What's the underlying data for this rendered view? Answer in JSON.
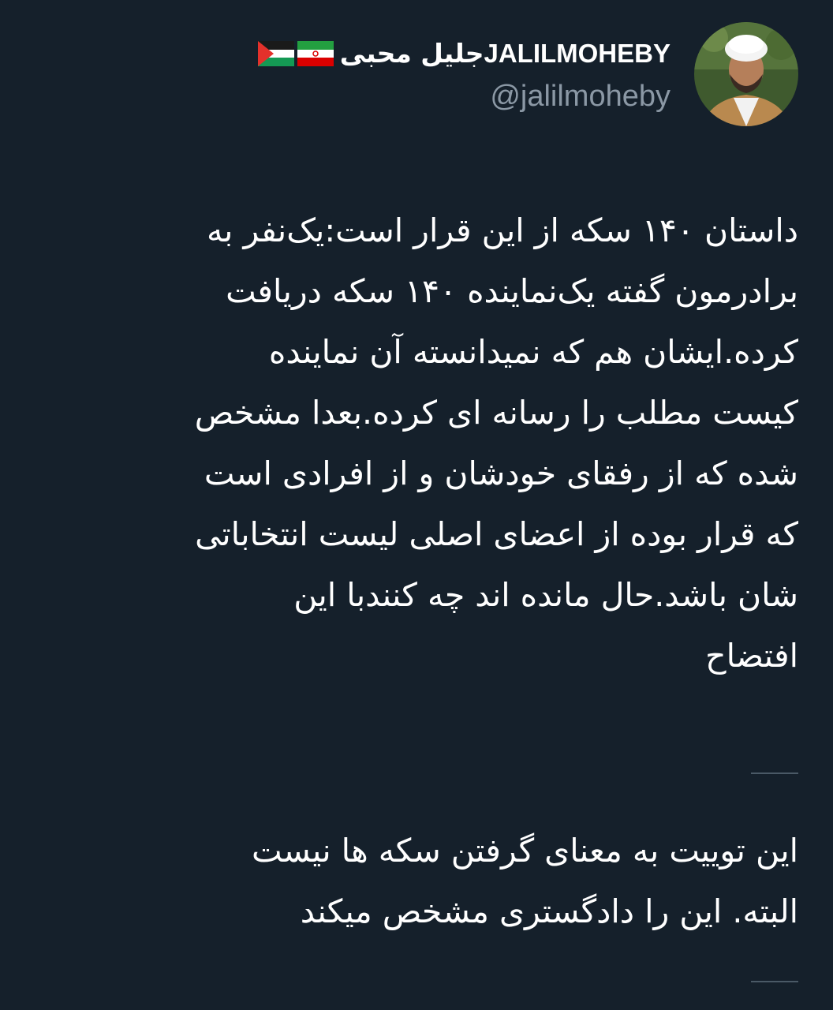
{
  "tweet": {
    "author": {
      "display_name_fa": "جلیل محبی",
      "display_name_en": "JALILMOHEBY",
      "handle": "@jalilmoheby",
      "flags": [
        "iran-flag",
        "palestine-flag"
      ],
      "avatar": "profile-photo"
    },
    "text_lines": [
      "داستان ۱۴۰ سکه از این قرار است:یک‌نفر به",
      "برادرمون گفته یک‌نماینده ۱۴۰ سکه دریافت",
      "کرده.ایشان هم که نمیدانسته آن نماینده",
      "کیست مطلب را رسانه ای کرده.بعدا مشخص",
      "شده که از رفقای خودشان و از افرادی است",
      "که قرار بوده از اعضای اصلی لیست انتخاباتی",
      "شان باشد.حال مانده اند چه کنندبا این",
      "افتضاح"
    ],
    "note_lines": [
      "این توییت به معنای گرفتن سکه ها نیست",
      "البته. این را دادگستری مشخص میکند"
    ]
  },
  "colors": {
    "background": "#15202b",
    "text": "#ffffff",
    "secondary_text": "#8b98a5",
    "divider": "#4a5966"
  }
}
